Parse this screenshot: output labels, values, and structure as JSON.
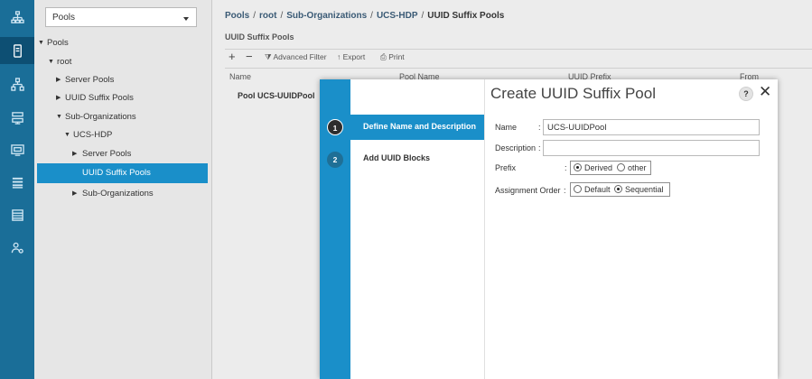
{
  "rail": {
    "icons": [
      "network-icon",
      "servers-icon",
      "lan-icon",
      "storage-icon",
      "vm-icon",
      "chassis-icon",
      "list-icon",
      "admin-icon"
    ],
    "active_index": 1
  },
  "nav": {
    "select_value": "Pools",
    "tree": [
      {
        "label": "Pools",
        "arrow": "▼"
      },
      {
        "label": "root",
        "arrow": "▼"
      },
      {
        "label": "Server Pools",
        "arrow": "▶"
      },
      {
        "label": "UUID Suffix Pools",
        "arrow": "▶"
      },
      {
        "label": "Sub-Organizations",
        "arrow": "▼"
      },
      {
        "label": "UCS-HDP",
        "arrow": "▼"
      },
      {
        "label": "Server Pools",
        "arrow": "▶"
      },
      {
        "label": "UUID Suffix Pools",
        "arrow": ""
      },
      {
        "label": "Sub-Organizations",
        "arrow": "▶"
      }
    ]
  },
  "main": {
    "breadcrumbs": [
      "Pools",
      "root",
      "Sub-Organizations",
      "UCS-HDP"
    ],
    "breadcrumb_current": "UUID Suffix Pools",
    "subtitle": "UUID Suffix Pools",
    "toolbar": {
      "add": "+",
      "remove": "−",
      "filter": "Advanced Filter",
      "export": "Export",
      "print": "Print"
    },
    "columns": [
      "Name",
      "Pool Name",
      "UUID Prefix",
      "From"
    ],
    "row_name": "Pool UCS-UUIDPool"
  },
  "modal": {
    "title": "Create UUID Suffix Pool",
    "help": "?",
    "close": "✕",
    "steps": [
      {
        "num": "1",
        "label": "Define Name and Description"
      },
      {
        "num": "2",
        "label": "Add UUID Blocks"
      }
    ],
    "form": {
      "name_label": "Name",
      "name_value": "UCS-UUIDPool",
      "description_label": "Description",
      "description_value": "",
      "prefix_label": "Prefix",
      "prefix_options": [
        "Derived",
        "other"
      ],
      "prefix_selected": "Derived",
      "order_label": "Assignment Order",
      "order_options": [
        "Default",
        "Sequential"
      ],
      "order_selected": "Sequential",
      "colon": ":"
    }
  }
}
